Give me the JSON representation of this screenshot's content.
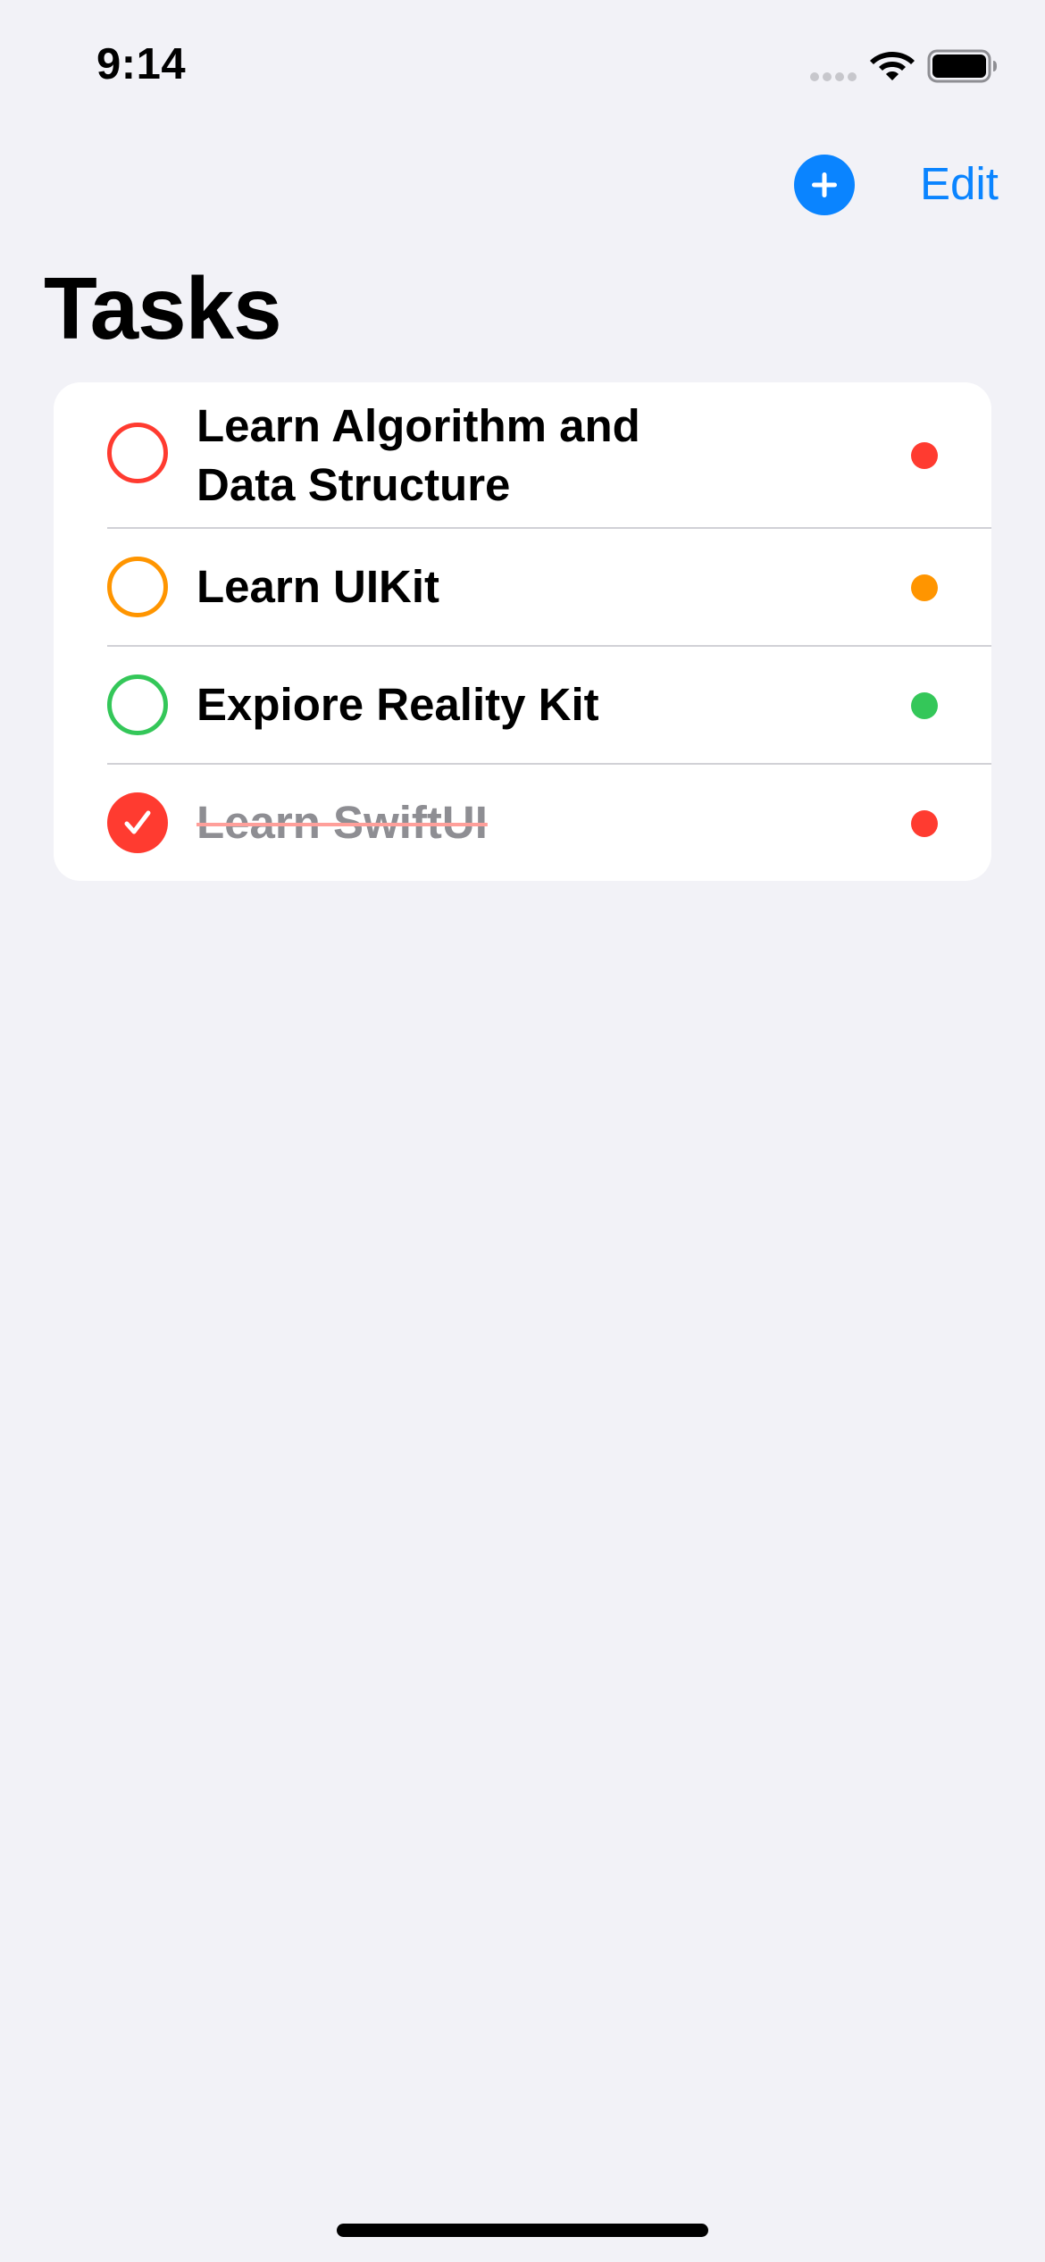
{
  "status_bar": {
    "time": "9:14",
    "signal_icon": "cellular-signal-icon",
    "wifi_icon": "wifi-icon",
    "battery_icon": "battery-icon"
  },
  "nav": {
    "add_icon": "plus-circle-icon",
    "edit_label": "Edit"
  },
  "title": "Tasks",
  "tasks": [
    {
      "title": "Learn Algorithm and Data Structure",
      "completed": false,
      "color": "#ff3b30"
    },
    {
      "title": "Learn UIKit",
      "completed": false,
      "color": "#ff9500"
    },
    {
      "title": "Expiore Reality Kit",
      "completed": false,
      "color": "#34c759"
    },
    {
      "title": "Learn SwiftUI",
      "completed": true,
      "color": "#ff3b30"
    }
  ],
  "colors": {
    "accent": "#0a84ff",
    "background": "#f2f2f7",
    "card": "#ffffff",
    "red": "#ff3b30",
    "orange": "#ff9500",
    "green": "#34c759"
  }
}
